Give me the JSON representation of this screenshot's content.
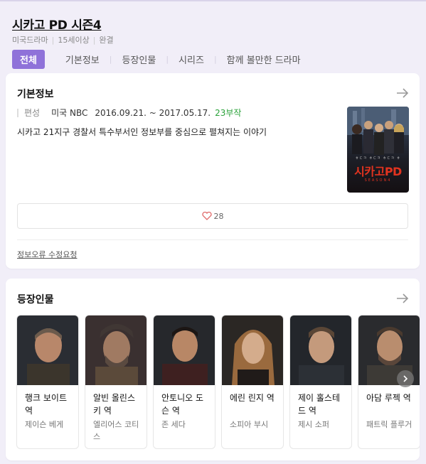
{
  "header": {
    "title": "시카고 PD 시즌4",
    "meta": [
      "미국드라마",
      "15세이상",
      "완결"
    ],
    "tabs": [
      {
        "label": "전체",
        "active": true
      },
      {
        "label": "기본정보",
        "active": false
      },
      {
        "label": "등장인물",
        "active": false
      },
      {
        "label": "시리즈",
        "active": false
      },
      {
        "label": "함께 볼만한 드라마",
        "active": false
      }
    ]
  },
  "basic_info": {
    "title": "기본정보",
    "label": "편성",
    "network": "미국 NBC",
    "dates": "2016.09.21. ~ 2017.05.17.",
    "episodes": "23부작",
    "synopsis": "시카고 21지구 경찰서 특수부서인 정보부를 중심으로 펼쳐지는 이야기",
    "poster": {
      "title": "시카고PD",
      "subtitle": "ㅎㄷㅋ ㅎㄷㅋ ㅎㄷㅋ ㅎ",
      "season": "SEASON4"
    },
    "like_count": "28",
    "report_label": "정보오류 수정요청"
  },
  "cast": {
    "title": "등장인물",
    "members": [
      {
        "role": "행크 보이트 역",
        "actor": "제이슨 베게"
      },
      {
        "role": "알빈 올린스키 역",
        "actor": "엘리어스 코티스"
      },
      {
        "role": "안토니오 도슨 역",
        "actor": "존 세다"
      },
      {
        "role": "에린 린지 역",
        "actor": "소피아 부시"
      },
      {
        "role": "제이 홀스테드 역",
        "actor": "제시 소퍼"
      },
      {
        "role": "아담 루젝 역",
        "actor": "패트릭 플루거"
      }
    ]
  },
  "colors": {
    "accent": "#8f72d9",
    "background": "#f1eef8",
    "episodes_green": "#2aa23a",
    "heart": "#e06a6a"
  },
  "icons": {
    "arrow": "arrow-right-icon",
    "heart": "heart-icon",
    "next": "chevron-right-icon"
  }
}
